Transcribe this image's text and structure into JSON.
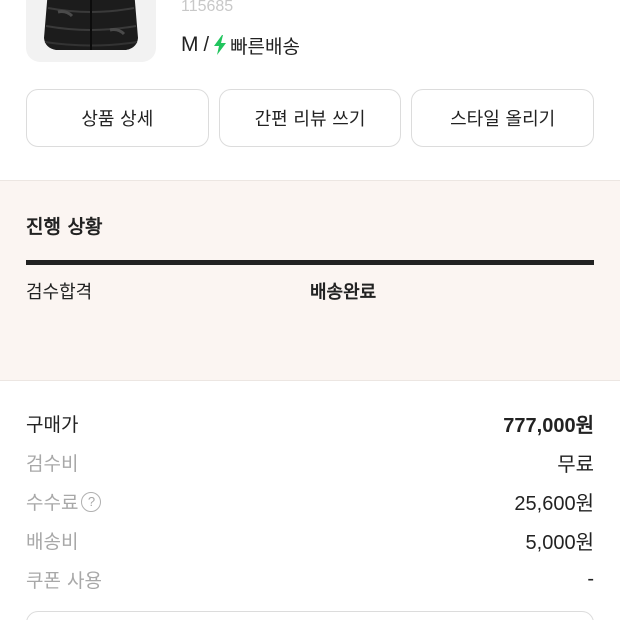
{
  "product": {
    "model_number": "115685",
    "size": "M",
    "separator": "/",
    "shipping_label": "빠른배송",
    "thumbnail_icon": "padded-jacket-image",
    "bolt_color": "#22c55e"
  },
  "actions": [
    {
      "label": "상품 상세"
    },
    {
      "label": "간편 리뷰 쓰기"
    },
    {
      "label": "스타일 올리기"
    }
  ],
  "progress": {
    "title": "진행 상황",
    "step": "검수합격",
    "status": "배송완료",
    "background_color": "#fbf5f2"
  },
  "prices": [
    {
      "label": "구매가",
      "value": "777,000원"
    },
    {
      "label": "검수비",
      "value": "무료"
    },
    {
      "label": "수수료",
      "value": "25,600원",
      "help_icon": "?"
    },
    {
      "label": "배송비",
      "value": "5,000원"
    },
    {
      "label": "쿠폰 사용",
      "value": "-"
    }
  ]
}
